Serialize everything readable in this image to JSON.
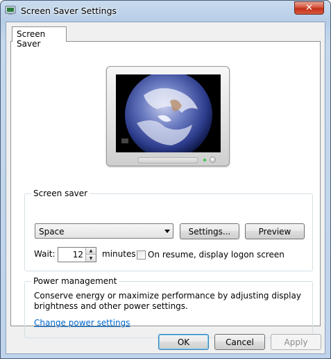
{
  "window": {
    "title": "Screen Saver Settings",
    "close_glyph": "✕"
  },
  "tabs": [
    {
      "label": "Screen Saver",
      "selected": true
    }
  ],
  "screen_saver_group": {
    "legend": "Screen saver",
    "selected_saver": "Space",
    "settings_button": "Settings...",
    "preview_button": "Preview",
    "wait_label": "Wait:",
    "wait_minutes": "12",
    "minutes_label": "minutes",
    "resume_checkbox_label": "On resume, display logon screen",
    "resume_checked": false
  },
  "power_group": {
    "legend": "Power management",
    "description_line1": "Conserve energy or maximize performance by adjusting display",
    "description_line2": "brightness and other power settings.",
    "link": "Change power settings"
  },
  "buttons": {
    "ok": "OK",
    "cancel": "Cancel",
    "apply": "Apply"
  },
  "colors": {
    "link": "#0066cc",
    "close_button": "#c2301a",
    "default_button_border": "#3c7fb1"
  },
  "icons": {
    "app": "screen-saver-app-icon",
    "close": "close-icon",
    "dropdown": "chevron-down-icon",
    "spin_up": "spin-up-icon",
    "spin_down": "spin-down-icon"
  }
}
